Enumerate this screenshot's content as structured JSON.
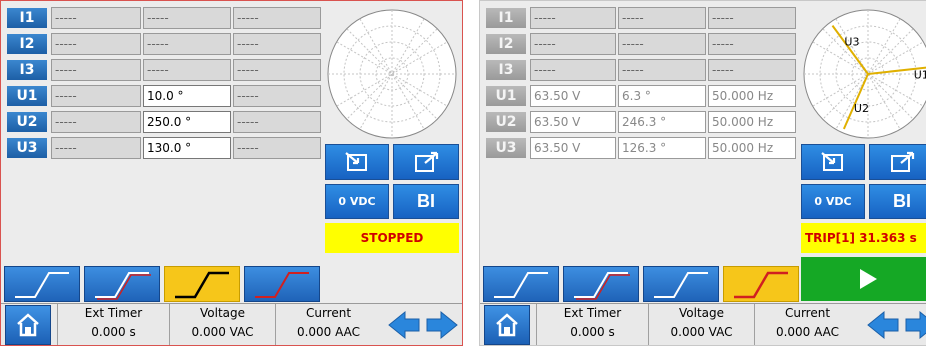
{
  "colors": {
    "tab_blue": "#2a78cf",
    "tab_active": "#f6c61a",
    "status_bg": "#ffff00",
    "status_text": "#d00000",
    "play_green": "#15a825"
  },
  "left": {
    "rows": [
      {
        "tag": "I1",
        "c1": "-----",
        "c2": "-----",
        "c3": "-----"
      },
      {
        "tag": "I2",
        "c1": "-----",
        "c2": "-----",
        "c3": "-----"
      },
      {
        "tag": "I3",
        "c1": "-----",
        "c2": "-----",
        "c3": "-----"
      },
      {
        "tag": "U1",
        "c1": "-----",
        "c2": "10.0 °",
        "c3": "-----"
      },
      {
        "tag": "U2",
        "c1": "-----",
        "c2": "250.0 °",
        "c3": "-----"
      },
      {
        "tag": "U3",
        "c1": "-----",
        "c2": "130.0 °",
        "c3": "-----"
      }
    ],
    "vdc_label": "0 VDC",
    "bi_label": "BI",
    "status": "STOPPED",
    "meters": {
      "ext_timer": {
        "label": "Ext Timer",
        "value": "0.000 s"
      },
      "voltage": {
        "label": "Voltage",
        "value": "0.000 VAC"
      },
      "current": {
        "label": "Current",
        "value": "0.000 AAC"
      }
    },
    "active_tab": 2
  },
  "right": {
    "rows": [
      {
        "tag": "I1",
        "c1": "-----",
        "c2": "-----",
        "c3": "-----"
      },
      {
        "tag": "I2",
        "c1": "-----",
        "c2": "-----",
        "c3": "-----"
      },
      {
        "tag": "I3",
        "c1": "-----",
        "c2": "-----",
        "c3": "-----"
      },
      {
        "tag": "U1",
        "c1": "63.50 V",
        "c2": "6.3 °",
        "c3": "50.000 Hz"
      },
      {
        "tag": "U2",
        "c1": "63.50 V",
        "c2": "246.3 °",
        "c3": "50.000 Hz"
      },
      {
        "tag": "U3",
        "c1": "63.50 V",
        "c2": "126.3 °",
        "c3": "50.000 Hz"
      }
    ],
    "phasors": [
      {
        "label": "U1",
        "angle_deg": 6.3,
        "magnitude": 1.0
      },
      {
        "label": "U2",
        "angle_deg": 246.3,
        "magnitude": 1.0
      },
      {
        "label": "U3",
        "angle_deg": 126.3,
        "magnitude": 1.0
      }
    ],
    "vdc_label": "0 VDC",
    "bi_label": "BI",
    "status": "TRIP[1] 31.363 s",
    "meters": {
      "ext_timer": {
        "label": "Ext Timer",
        "value": "0.000 s"
      },
      "voltage": {
        "label": "Voltage",
        "value": "0.000 VAC"
      },
      "current": {
        "label": "Current",
        "value": "0.000 AAC"
      }
    },
    "active_tab": 3
  }
}
